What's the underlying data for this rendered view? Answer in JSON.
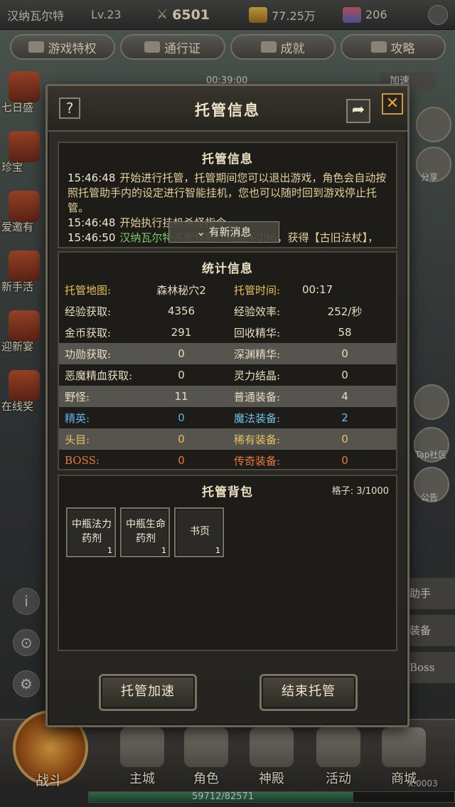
{
  "player": {
    "name": "汉纳瓦尔特",
    "level": "Lv.23"
  },
  "resources": {
    "power": "6501",
    "gold": "77.25万",
    "gems": "206"
  },
  "top_menu": [
    "游戏特权",
    "通行证",
    "成就",
    "攻略"
  ],
  "bg_timer": "00:39:00",
  "bg_speed": "加速",
  "left_side": [
    "七日盛",
    "珍宝",
    "爱邀有",
    "新手活",
    "迎新宴",
    "在线奖"
  ],
  "left_side_sub": [
    "6天08:1",
    "6天08:1"
  ],
  "right_side_labels": {
    "share": "分享",
    "tap": "Tap社区",
    "notice": "公告"
  },
  "right_side_btns": [
    "助手",
    "装备",
    "Boss"
  ],
  "bottom_nav": {
    "battle": "战斗",
    "items": [
      "主城",
      "角色",
      "神殿",
      "活动",
      "商城"
    ]
  },
  "hp": {
    "text": "59712/82571",
    "fraction": 0.723
  },
  "coord": "x:0003",
  "modal": {
    "title": "托管信息",
    "help_icon": "?",
    "share_icon": "➦",
    "close_icon": "✕",
    "log": {
      "title": "托管信息",
      "lines": [
        {
          "time": "15:46:48",
          "text": "开始进行托管，托管期间您可以退出游戏，角色会自动按照托管助手内的设定进行智能挂机，您也可以随时回到游戏停止托管。"
        },
        {
          "time": "15:46:48",
          "text": "开始执行挂机杀怪指令"
        },
        {
          "time": "15:46:50",
          "green": "汉纳瓦尔特",
          "text": "杀死怪物，经验+396，获得【古旧法杖】，自动回收了【古旧法杖】"
        }
      ],
      "new_msg_tip": "有新消息"
    },
    "stats": {
      "title": "统计信息",
      "rows": [
        {
          "k1": "托管地图:",
          "v1": "森林秘穴2",
          "k2": "托管时间:",
          "v2": "00:17"
        },
        {
          "k1": "经验获取:",
          "v1": "4356",
          "k2": "经验效率:",
          "v2": "252/秒"
        },
        {
          "k1": "金币获取:",
          "v1": "291",
          "k2": "回收精华:",
          "v2": "58"
        },
        {
          "k1": "功勋获取:",
          "v1": "0",
          "k2": "深渊精华:",
          "v2": "0"
        },
        {
          "k1": "恶魔精血获取:",
          "v1": "0",
          "k2": "灵力结晶:",
          "v2": "0"
        },
        {
          "k1": "野怪:",
          "v1": "11",
          "k2": "普通装备:",
          "v2": "4"
        },
        {
          "k1": "精英:",
          "v1": "0",
          "k2": "魔法装备:",
          "v2": "2"
        },
        {
          "k1": "头目:",
          "v1": "0",
          "k2": "稀有装备:",
          "v2": "0"
        },
        {
          "k1": "BOSS:",
          "v1": "0",
          "k2": "传奇装备:",
          "v2": "0"
        }
      ]
    },
    "bag": {
      "title": "托管背包",
      "capacity": "格子: 3/1000",
      "items": [
        {
          "name": "中瓶法力药剂",
          "count": "1"
        },
        {
          "name": "中瓶生命药剂",
          "count": "1"
        },
        {
          "name": "书页",
          "count": "1"
        }
      ]
    },
    "buttons": {
      "speed": "托管加速",
      "end": "结束托管"
    }
  }
}
